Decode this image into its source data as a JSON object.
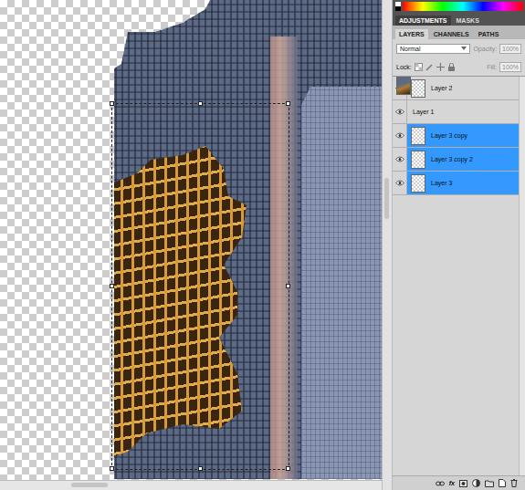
{
  "panel_tabs": [
    {
      "label": "ADJUSTMENTS",
      "selected": true
    },
    {
      "label": "MASKS",
      "selected": false
    }
  ],
  "layer_tabs": [
    {
      "label": "LAYERS",
      "selected": true
    },
    {
      "label": "CHANNELS",
      "selected": false
    },
    {
      "label": "PATHS",
      "selected": false
    }
  ],
  "blend_mode": "Normal",
  "opacity": {
    "label": "Opacity:",
    "value": "100%",
    "disabled": true
  },
  "lock": {
    "label": "Lock:"
  },
  "fill": {
    "label": "Fill:",
    "value": "100%",
    "disabled": true
  },
  "layers": [
    {
      "name": "Layer 2",
      "visible": true,
      "selected": false,
      "kind": "empty"
    },
    {
      "name": "Layer 1",
      "visible": true,
      "selected": false,
      "kind": "photo"
    },
    {
      "name": "Layer 3 copy",
      "visible": true,
      "selected": true,
      "kind": "empty"
    },
    {
      "name": "Layer 3 copy 2",
      "visible": true,
      "selected": true,
      "kind": "empty"
    },
    {
      "name": "Layer 3",
      "visible": true,
      "selected": true,
      "kind": "empty"
    }
  ],
  "footer": {
    "fx_label": "fx"
  }
}
